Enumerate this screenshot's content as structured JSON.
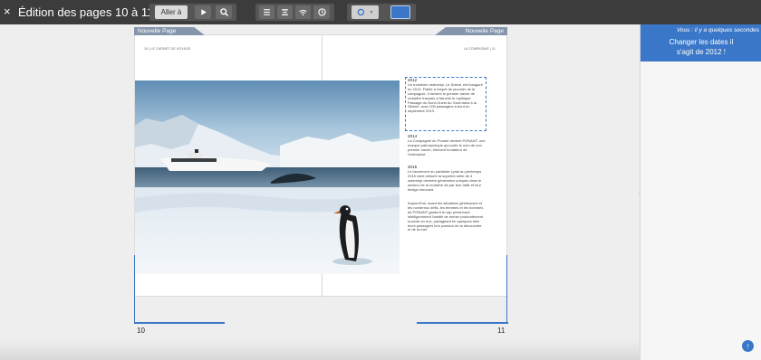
{
  "app": {
    "close_label": "×",
    "title": "Édition des pages 10 à 11"
  },
  "toolbar": {
    "goto_label": "Aller à",
    "accent_color": "#3a77c8"
  },
  "notification": {
    "timestamp": "Vous : il y a quelques secondes",
    "message_line1": "Changer les dates il",
    "message_line2": "s'agit de 2012 !"
  },
  "book": {
    "left_tab": "Nouvelle Page",
    "right_tab": "Nouvelle Page",
    "left_header": "10 | LE CARNET DE VOYAGE",
    "right_header": "LA COMPAGNIE | 11",
    "left_page_number": "10",
    "right_page_number": "11",
    "text_blocks": [
      {
        "year": "2012",
        "body": "Un troisième ostership, Le Soleal, est inauguré en 2013. Fidèle à l'esprit de pionnier de la compagnie, il devient le premier navire de croisière français à franchir le mythique Passage du Nord-Ouest du Groenland à la Sibérie, avec 200 passagers à bord en septembre 2013."
      },
      {
        "year": "2014",
        "body": "La Compagnie du Ponant devient PONANT, une marque patronymique qui porte le nom de son premier navire, élément fondateur de l'entreprise."
      },
      {
        "year": "2015",
        "body": "Le lancement du yachtiste Lyrial au printemps 2015 vient clôturer la superbe série de 4 ostership dernière génération uniques dans le secteur de la croisière de par leur taille et leur design innovant."
      },
      {
        "year": "",
        "body": "Aujourd'hui, avant les situations géniesuses et les nombreux défis, les femmes et les hommes de PONANT gardent le cap preservant intelligemment l'amitié de mener profondément ouverte en eux, partageant en quelques bien leurs passagers leur passion de la découverte et de la mer."
      }
    ]
  },
  "icons": {
    "play": "play-icon",
    "zoom": "zoom-icon",
    "align": "align-icon",
    "history": "history-icon",
    "help": "help-icon"
  }
}
